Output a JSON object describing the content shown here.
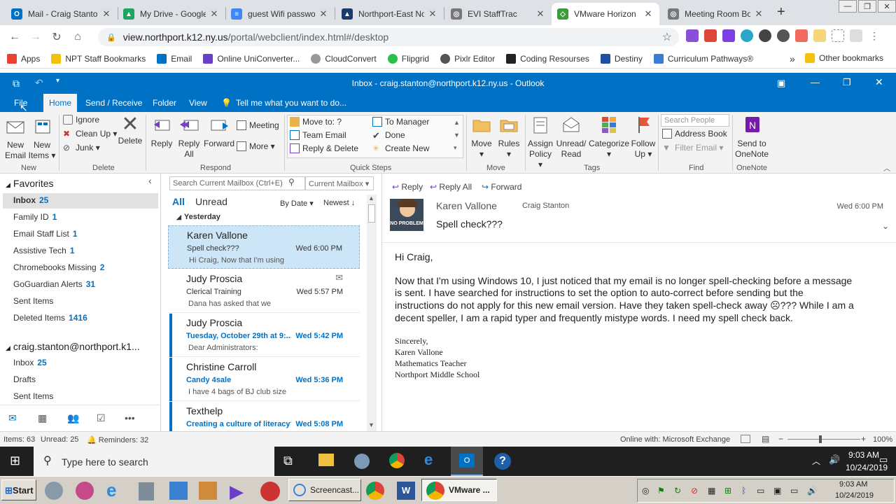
{
  "browser": {
    "tabs": [
      {
        "title": "Mail - Craig Stanto",
        "icon_color": "#0072c6",
        "icon": "outlook-icon"
      },
      {
        "title": "My Drive - Google",
        "icon_color": "#1fa463",
        "icon": "drive-icon"
      },
      {
        "title": "guest Wifi passwo",
        "icon_color": "#4285f4",
        "icon": "docs-icon"
      },
      {
        "title": "Northport-East No",
        "icon_color": "#1a3a6b",
        "icon": "northport-icon"
      },
      {
        "title": "EVI StaffTrac",
        "icon_color": "#777777",
        "icon": "globe-icon"
      },
      {
        "title": "VMware Horizon",
        "icon_color": "#3c9b3c",
        "icon": "vmware-icon"
      },
      {
        "title": "Meeting Room Boo",
        "icon_color": "#777777",
        "icon": "globe-icon"
      }
    ],
    "url_host": "view.northport.k12.ny.us",
    "url_path": "/portal/webclient/index.html#/desktop",
    "bookmarks": [
      "Apps",
      "NPT Staff Bookmarks",
      "Email",
      "Online UniConverter...",
      "CloudConvert",
      "Flipgrid",
      "Pixlr Editor",
      "Coding Resourses",
      "Destiny",
      "Curriculum Pathways®"
    ],
    "other_bookmarks": "Other bookmarks",
    "more_bookmarks": "»"
  },
  "outlook": {
    "title": "Inbox - craig.stanton@northport.k12.ny.us - Outlook",
    "tabs": [
      "File",
      "Home",
      "Send / Receive",
      "Folder",
      "View"
    ],
    "tell_me": "Tell me what you want to do...",
    "ribbon": {
      "new_email": [
        "New",
        "Email"
      ],
      "new_items": [
        "New",
        "Items"
      ],
      "ignore": "Ignore",
      "clean_up": "Clean Up",
      "junk": "Junk",
      "delete": "Delete",
      "reply": "Reply",
      "reply_all": [
        "Reply",
        "All"
      ],
      "forward": "Forward",
      "meeting": "Meeting",
      "more": "More",
      "quick_steps": [
        "Move to: ?",
        "Team Email",
        "Reply & Delete",
        "To Manager",
        "Done",
        "Create New"
      ],
      "move": "Move",
      "rules": "Rules",
      "assign_policy": [
        "Assign",
        "Policy"
      ],
      "unread_read": [
        "Unread/",
        "Read"
      ],
      "categorize": "Categorize",
      "follow_up": [
        "Follow",
        "Up"
      ],
      "search_people": "Search People",
      "address_book": "Address Book",
      "filter_email": "Filter Email",
      "send_onenote": [
        "Send to",
        "OneNote"
      ],
      "groups": [
        "New",
        "Delete",
        "Respond",
        "Quick Steps",
        "Move",
        "Tags",
        "Find",
        "OneNote"
      ]
    },
    "favorites": {
      "header": "Favorites",
      "items": [
        {
          "label": "Inbox",
          "count": "25"
        },
        {
          "label": "Family ID",
          "count": "1"
        },
        {
          "label": "Email Staff List",
          "count": "1"
        },
        {
          "label": "Assistive Tech",
          "count": "1"
        },
        {
          "label": "Chromebooks Missing",
          "count": "2"
        },
        {
          "label": "GoGuardian Alerts",
          "count": "31"
        },
        {
          "label": "Sent Items",
          "count": ""
        },
        {
          "label": "Deleted Items",
          "count": "1416"
        }
      ]
    },
    "account": {
      "name": "craig.stanton@northport.k1...",
      "items": [
        {
          "label": "Inbox",
          "count": "25"
        },
        {
          "label": "Drafts",
          "count": ""
        },
        {
          "label": "Sent Items",
          "count": ""
        }
      ]
    },
    "search": {
      "placeholder": "Search Current Mailbox (Ctrl+E)",
      "scope": "Current Mailbox"
    },
    "filters": {
      "all": "All",
      "unread": "Unread",
      "sort": "By Date",
      "order": "Newest"
    },
    "group_label": "Yesterday",
    "messages": [
      {
        "from": "Karen Vallone",
        "subject": "Spell check???",
        "date": "Wed 6:00 PM",
        "preview": "Hi Craig,  Now that I'm using",
        "selected": true,
        "unread": false
      },
      {
        "from": "Judy Proscia",
        "subject": "Clerical Training",
        "date": "Wed 5:57 PM",
        "preview": "Dana has asked that we",
        "selected": false,
        "unread": false
      },
      {
        "from": "Judy Proscia",
        "subject": "Tuesday, October 29th at 9:...",
        "date": "Wed 5:42 PM",
        "preview": "Dear Administrators:",
        "selected": false,
        "unread": true
      },
      {
        "from": "Christine Carroll",
        "subject": "Candy 4sale",
        "date": "Wed 5:36 PM",
        "preview": "I have 4 bags of BJ club size",
        "selected": false,
        "unread": true
      },
      {
        "from": "Texthelp",
        "subject": "Creating a culture of literacy?",
        "date": "Wed 5:08 PM",
        "preview": "",
        "selected": false,
        "unread": true
      }
    ],
    "reading": {
      "actions": [
        "Reply",
        "Reply All",
        "Forward"
      ],
      "from": "Karen Vallone",
      "to": "Craig Stanton",
      "date": "Wed 6:00 PM",
      "subject": "Spell check???",
      "greeting": "Hi Craig,",
      "body_lines": [
        "Now that I'm using Windows 10, I just noticed that my email is no longer spell-checking before a message",
        "is sent.  I have searched for instructions to set the option to auto-correct before sending but the",
        "instructions do not apply for this new email version.  Have they taken spell-check away ☹??? While I am a",
        "decent speller, I am a rapid typer and frequently mistype words.  I need my spell check back."
      ],
      "signature": [
        "Sincerely,",
        "Karen Vallone",
        "Mathematics Teacher",
        "Northport Middle School"
      ],
      "avatar_text": "NO PROBLEM"
    },
    "status": {
      "items": "Items: 63",
      "unread": "Unread: 25",
      "reminders": "Reminders: 32",
      "connection": "Online with: Microsoft Exchange",
      "zoom": "100%"
    }
  },
  "windows": {
    "search_placeholder": "Type here to search",
    "time": "9:03 AM",
    "date": "10/24/2019"
  },
  "host_taskbar": {
    "start": "Start",
    "screencast": "Screencast...",
    "vmware": "VMware ...",
    "time": "9:03 AM",
    "date": "10/24/2019"
  }
}
